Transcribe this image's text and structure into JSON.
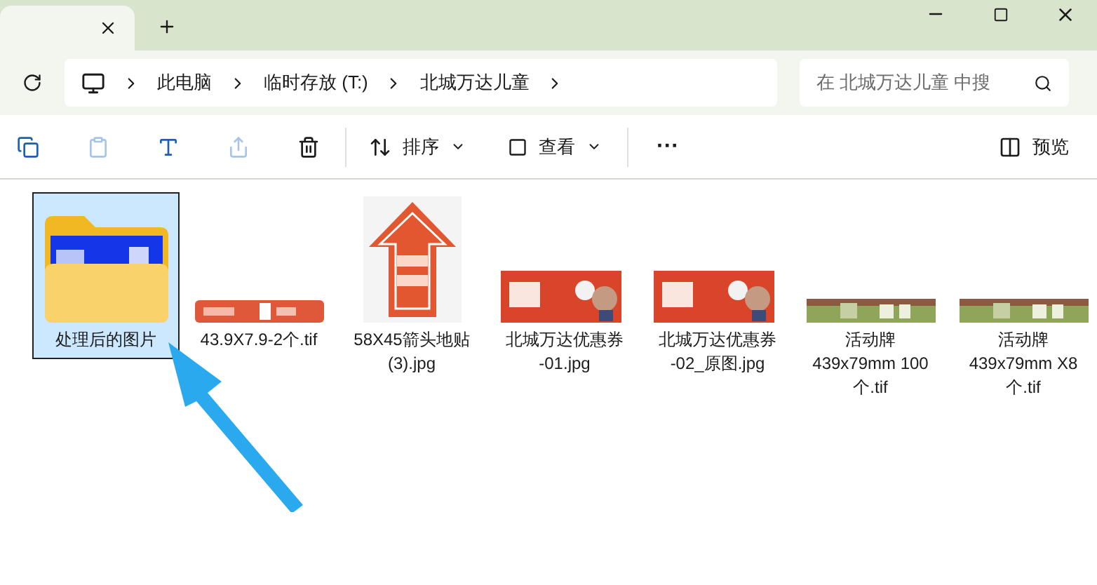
{
  "breadcrumbs": [
    "此电脑",
    "临时存放 (T:)",
    "北城万达儿童"
  ],
  "search": {
    "placeholder": "在 北城万达儿童 中搜"
  },
  "toolbar": {
    "sort": "排序",
    "view": "查看",
    "more": "···",
    "preview": "预览"
  },
  "files": [
    {
      "kind": "folder",
      "name": [
        "处理后的图片"
      ],
      "selected": true
    },
    {
      "kind": "banner",
      "name": [
        "43.9X7.9-2个.tif"
      ],
      "selected": false
    },
    {
      "kind": "arrow",
      "name": [
        "58X45箭头地贴",
        "(3).jpg"
      ],
      "selected": false
    },
    {
      "kind": "coupon",
      "name": [
        "北城万达优惠券",
        "-01.jpg"
      ],
      "selected": false
    },
    {
      "kind": "coupon",
      "name": [
        "北城万达优惠券",
        "-02_原图.jpg"
      ],
      "selected": false
    },
    {
      "kind": "sign",
      "name": [
        "活动牌",
        "439x79mm 100",
        "个.tif"
      ],
      "selected": false
    },
    {
      "kind": "sign",
      "name": [
        "活动牌",
        "439x79mm X8",
        "个.tif"
      ],
      "selected": false
    }
  ]
}
